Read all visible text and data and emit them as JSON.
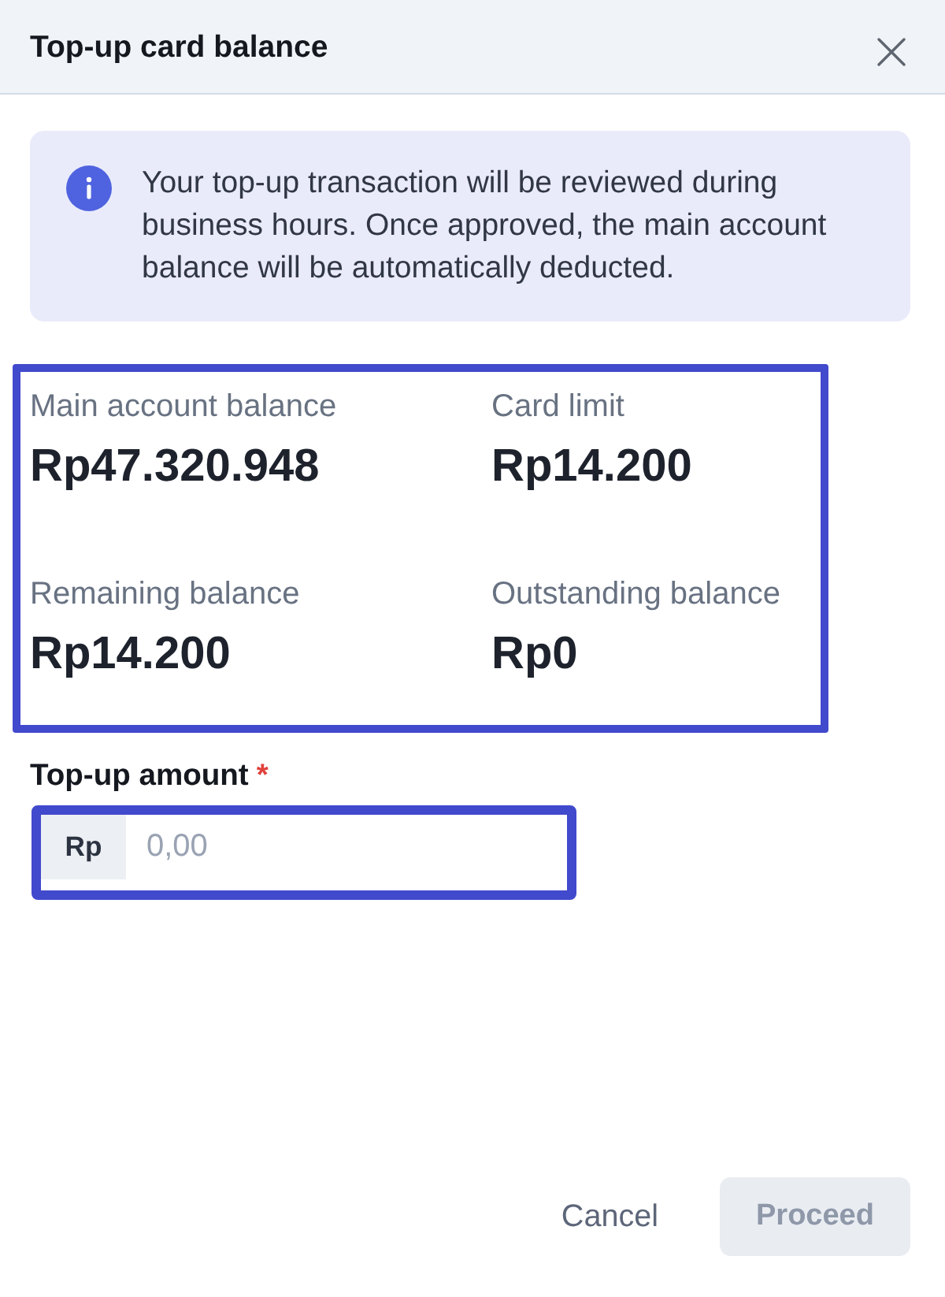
{
  "dialog": {
    "title": "Top-up card balance"
  },
  "notice": {
    "text": "Your top-up transaction will be reviewed during business hours. Once approved, the main account balance will be automatically deducted."
  },
  "balances": {
    "highlighted": true,
    "items": [
      {
        "label": "Main account balance",
        "value": "Rp47.320.948"
      },
      {
        "label": "Card limit",
        "value": "Rp14.200"
      },
      {
        "label": "Remaining balance",
        "value": "Rp14.200"
      },
      {
        "label": "Outstanding balance",
        "value": "Rp0"
      }
    ]
  },
  "amount_field": {
    "label": "Top-up amount",
    "required_mark": "*",
    "prefix": "Rp",
    "placeholder": "0,00",
    "highlighted": true
  },
  "actions": [
    {
      "label": "Cancel",
      "kind": "text",
      "disabled": false
    },
    {
      "label": "Proceed",
      "kind": "primary",
      "disabled": true
    }
  ]
}
